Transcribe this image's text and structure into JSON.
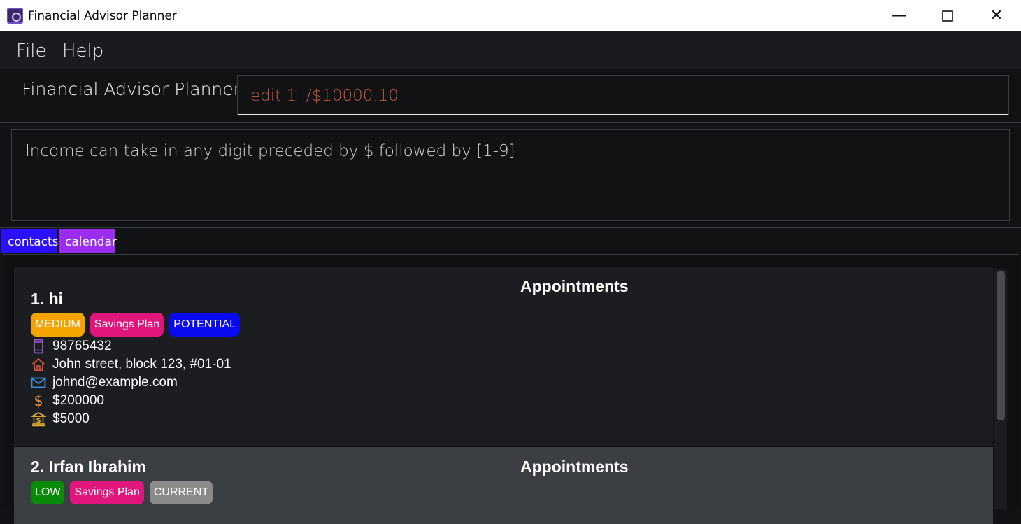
{
  "window": {
    "title": "Financial Advisor Planner",
    "minimize_glyph": "—",
    "maximize_glyph": "☐",
    "close_glyph": "✕"
  },
  "menu": {
    "items": [
      "File",
      "Help"
    ]
  },
  "command": {
    "app_label": "Financial Advisor Planner",
    "input_value": "edit 1 i/$10000.10"
  },
  "result": {
    "message": "Income can take in any digit preceded by $ followed by [1-9]"
  },
  "tabs": [
    "contacts",
    "calendar"
  ],
  "contacts": [
    {
      "name": "1.  hi",
      "tags": [
        {
          "label": "MEDIUM",
          "color": "#f5a300"
        },
        {
          "label": "Savings Plan",
          "color": "#e1167d"
        },
        {
          "label": "POTENTIAL",
          "color": "#0a0af0"
        }
      ],
      "phone": "98765432",
      "address": "John street, block 123, #01-01",
      "email": "johnd@example.com",
      "income": "$200000",
      "monthly": "$5000",
      "appointments_heading": "Appointments"
    },
    {
      "name": "2.  Irfan Ibrahim",
      "tags": [
        {
          "label": "LOW",
          "color": "#0a8a0a"
        },
        {
          "label": "Savings Plan",
          "color": "#e1167d"
        },
        {
          "label": "CURRENT",
          "color": "#8a8a8a"
        }
      ],
      "appointments_heading": "Appointments"
    }
  ],
  "colors": {
    "phone_icon": "#9b59d6",
    "home_icon": "#e0533a",
    "email_icon": "#3a8fe0",
    "income_icon": "#e8913a",
    "bank_icon": "#e8b33a"
  }
}
